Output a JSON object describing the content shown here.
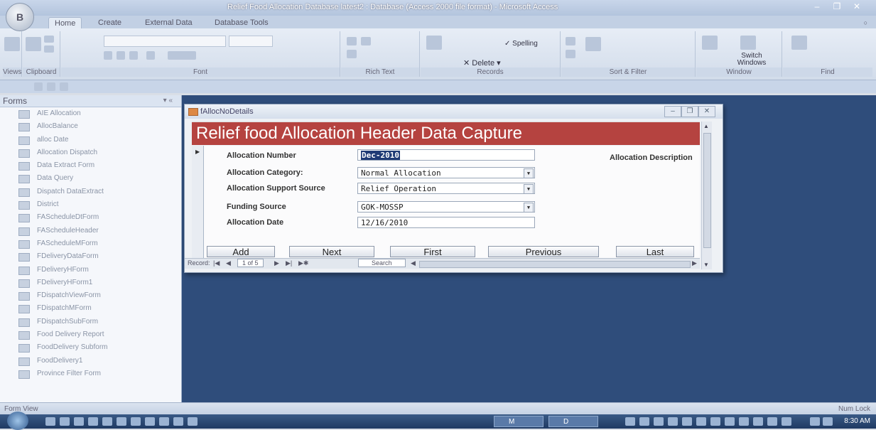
{
  "window": {
    "title": "Relief Food Allocation Database latest2 : Database (Access 2000 file format) - Microsoft Access",
    "office_button": "B"
  },
  "ribbon": {
    "tabs": [
      "Home",
      "Create",
      "External Data",
      "Database Tools"
    ],
    "active_tab": "Home",
    "groups": [
      "Views",
      "Clipboard",
      "Font",
      "Rich Text",
      "Records",
      "Sort & Filter",
      "Window",
      "Find"
    ],
    "commands": {
      "spelling": "Spelling",
      "delete": "Delete",
      "switch_windows": "Switch Windows"
    }
  },
  "nav": {
    "header": "Forms",
    "items": [
      "AIE Allocation",
      "AllocBalance",
      "alloc Date",
      "Allocation Dispatch",
      "Data Extract Form",
      "Data Query",
      "Dispatch DataExtract",
      "District",
      "FAScheduleDtForm",
      "FAScheduleHeader",
      "FAScheduleMForm",
      "FDeliveryDataForm",
      "FDeliveryHForm",
      "FDeliveryHForm1",
      "FDispatchViewForm",
      "FDispatchMForm",
      "FDispatchSubForm",
      "Food Delivery Report",
      "FoodDelivery Subform",
      "FoodDelivery1",
      "Province Filter Form"
    ]
  },
  "form": {
    "window_name": "fAllocNoDetails",
    "header_title": "Relief food Allocation Header Data Capture",
    "fields": {
      "alloc_number": {
        "label": "Allocation Number",
        "value": "Dec-2010"
      },
      "alloc_category": {
        "label": "Allocation Category:",
        "value": "Normal Allocation"
      },
      "support_source": {
        "label": "Allocation Support Source",
        "value": "Relief Operation"
      },
      "funding_source": {
        "label": "Funding Source",
        "value": "GOK-MOSSP"
      },
      "alloc_date": {
        "label": "Allocation Date",
        "value": "12/16/2010"
      }
    },
    "description_label": "Allocation Description",
    "buttons": {
      "add": "Add",
      "next": "Next",
      "first": "First",
      "previous": "Previous",
      "last": "Last"
    },
    "record_nav": {
      "label": "Record:",
      "position": "1 of 5",
      "search": "Search"
    }
  },
  "status_bar": {
    "left": "Form View",
    "right": "Num Lock"
  },
  "taskbar": {
    "tasks": [
      "M",
      "D"
    ],
    "clock": "8:30 AM"
  },
  "colors": {
    "header_band": "#b54340",
    "workspace": "#2f4d7b",
    "selected_value_bg": "#1f3a75"
  }
}
